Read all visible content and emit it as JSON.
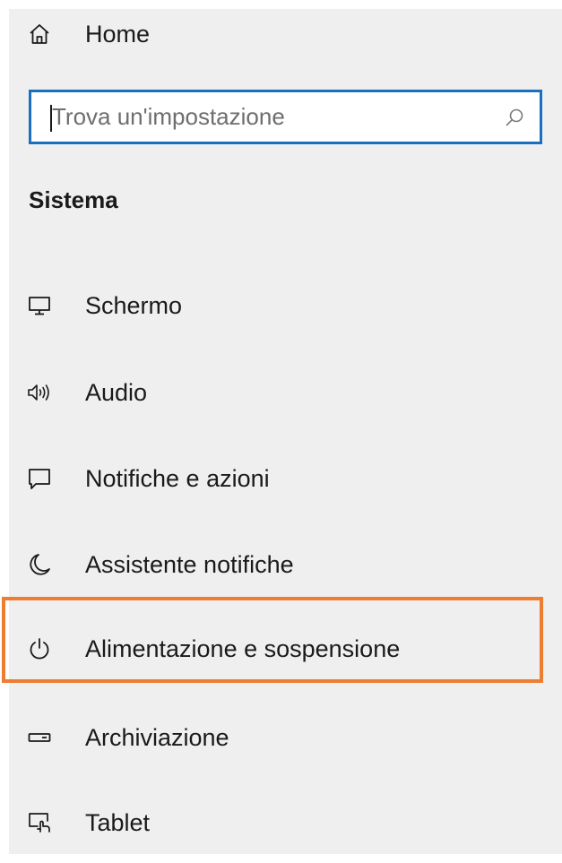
{
  "nav": {
    "home_label": "Home"
  },
  "search": {
    "placeholder": "Trova un'impostazione",
    "value": ""
  },
  "section": {
    "title": "Sistema"
  },
  "menu": {
    "items": [
      {
        "label": "Schermo",
        "icon": "monitor-icon"
      },
      {
        "label": "Audio",
        "icon": "speaker-icon"
      },
      {
        "label": "Notifiche e azioni",
        "icon": "notification-icon"
      },
      {
        "label": "Assistente notifiche",
        "icon": "moon-icon"
      },
      {
        "label": "Alimentazione e sospensione",
        "icon": "power-icon",
        "highlighted": true
      },
      {
        "label": "Archiviazione",
        "icon": "storage-drive-icon"
      },
      {
        "label": "Tablet",
        "icon": "tablet-mode-icon"
      }
    ]
  },
  "colors": {
    "panel_background": "#efefef",
    "search_border": "#1a70c0",
    "highlight_border": "#ed7d31",
    "text": "#1a1a1a"
  }
}
